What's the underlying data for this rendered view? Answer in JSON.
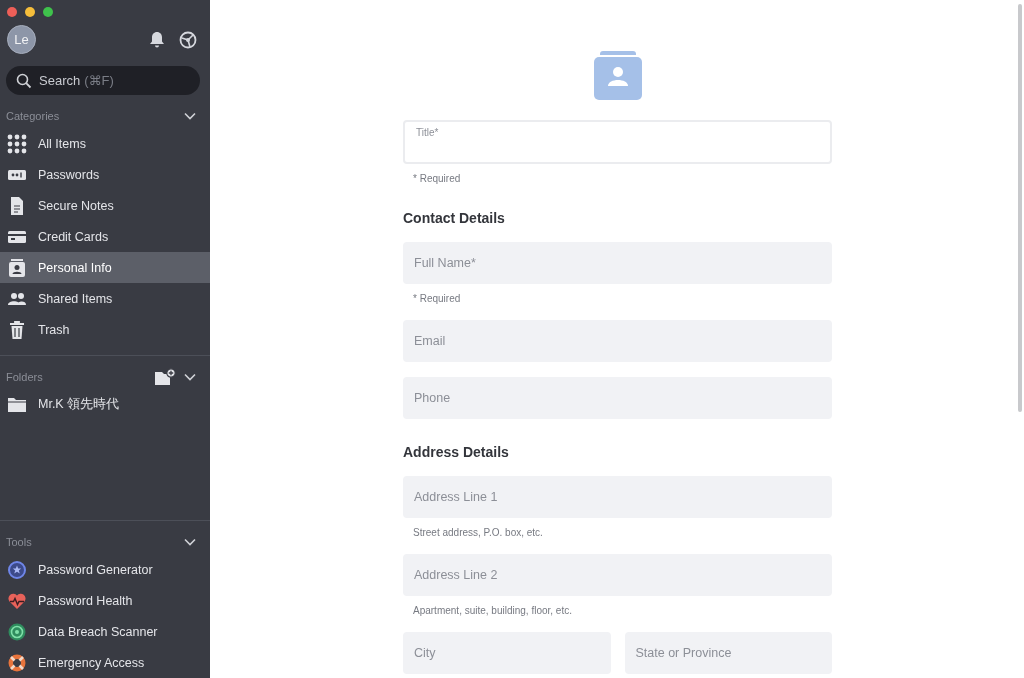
{
  "sidebar": {
    "avatar": "Le",
    "search": {
      "label": "Search",
      "shortcut": "(⌘F)"
    },
    "categories": {
      "heading": "Categories",
      "expanded": true,
      "items": [
        {
          "label": "All Items",
          "kind": "grid",
          "selected": false
        },
        {
          "label": "Passwords",
          "kind": "password",
          "selected": false
        },
        {
          "label": "Secure Notes",
          "kind": "note",
          "selected": false
        },
        {
          "label": "Credit Cards",
          "kind": "card",
          "selected": false
        },
        {
          "label": "Personal Info",
          "kind": "person",
          "selected": true
        },
        {
          "label": "Shared Items",
          "kind": "people",
          "selected": false
        },
        {
          "label": "Trash",
          "kind": "trash",
          "selected": false
        }
      ]
    },
    "folders": {
      "heading": "Folders",
      "expanded": true,
      "items": [
        {
          "label": "Mr.K 領先時代",
          "selected": false
        }
      ]
    },
    "tools": {
      "heading": "Tools",
      "expanded": true,
      "items": [
        {
          "label": "Password Generator",
          "kind": "generator"
        },
        {
          "label": "Password Health",
          "kind": "health"
        },
        {
          "label": "Data Breach Scanner",
          "kind": "scanner"
        },
        {
          "label": "Emergency Access",
          "kind": "lifebuoy"
        }
      ]
    }
  },
  "form": {
    "sections": [
      {
        "fields": [
          {
            "kind": "outlined",
            "label": "Title*",
            "hint": "* Required"
          }
        ]
      },
      {
        "heading": "Contact Details",
        "fields": [
          {
            "kind": "filled",
            "label": "Full Name*",
            "hint": "* Required"
          },
          {
            "kind": "filled",
            "label": "Email"
          },
          {
            "kind": "filled",
            "label": "Phone"
          }
        ]
      },
      {
        "heading": "Address Details",
        "fields": [
          {
            "kind": "filled",
            "label": "Address Line 1",
            "hint": "Street address, P.O. box, etc."
          },
          {
            "kind": "filled",
            "label": "Address Line 2",
            "hint": "Apartment, suite, building, floor, etc."
          },
          {
            "kind": "pair",
            "items": [
              "City",
              "State or Province"
            ]
          }
        ]
      }
    ]
  }
}
